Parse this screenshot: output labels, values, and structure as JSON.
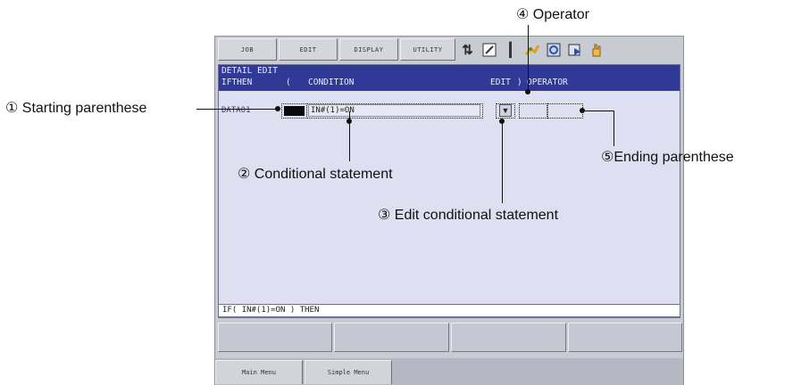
{
  "menu": {
    "job": "JOB",
    "edit": "EDIT",
    "display": "DISPLAY",
    "utility": "UTILITY"
  },
  "status_icons": [
    "coordinate-icon",
    "edit-mode-icon",
    "step-icon",
    "robot-icon",
    "cycle-icon",
    "play-icon",
    "hand-icon"
  ],
  "window": {
    "title": "DETAIL EDIT",
    "header": {
      "ifthen": "IFTHEN",
      "paren": "(",
      "condition": "CONDITION",
      "edit": "EDIT",
      "paren_close": ")",
      "operator": "OPERATOR"
    },
    "row": {
      "label": "DATA01",
      "condition": "IN#(1)=ON",
      "edit_arrow": "▼"
    }
  },
  "input_line": "IF( IN#(1)=ON ) THEN",
  "bottom": {
    "main_menu": "Main Menu",
    "simple_menu": "Simple Menu"
  },
  "callouts": {
    "starting": "① Starting parenthese",
    "conditional": "② Conditional statement",
    "edit_conditional": "③ Edit conditional statement",
    "operator": "④ Operator",
    "ending": "⑤Ending parenthese"
  },
  "colors": {
    "title_bar": "#303a96",
    "window_bg": "#dedff0",
    "panel_bg": "#c9cbd2"
  }
}
